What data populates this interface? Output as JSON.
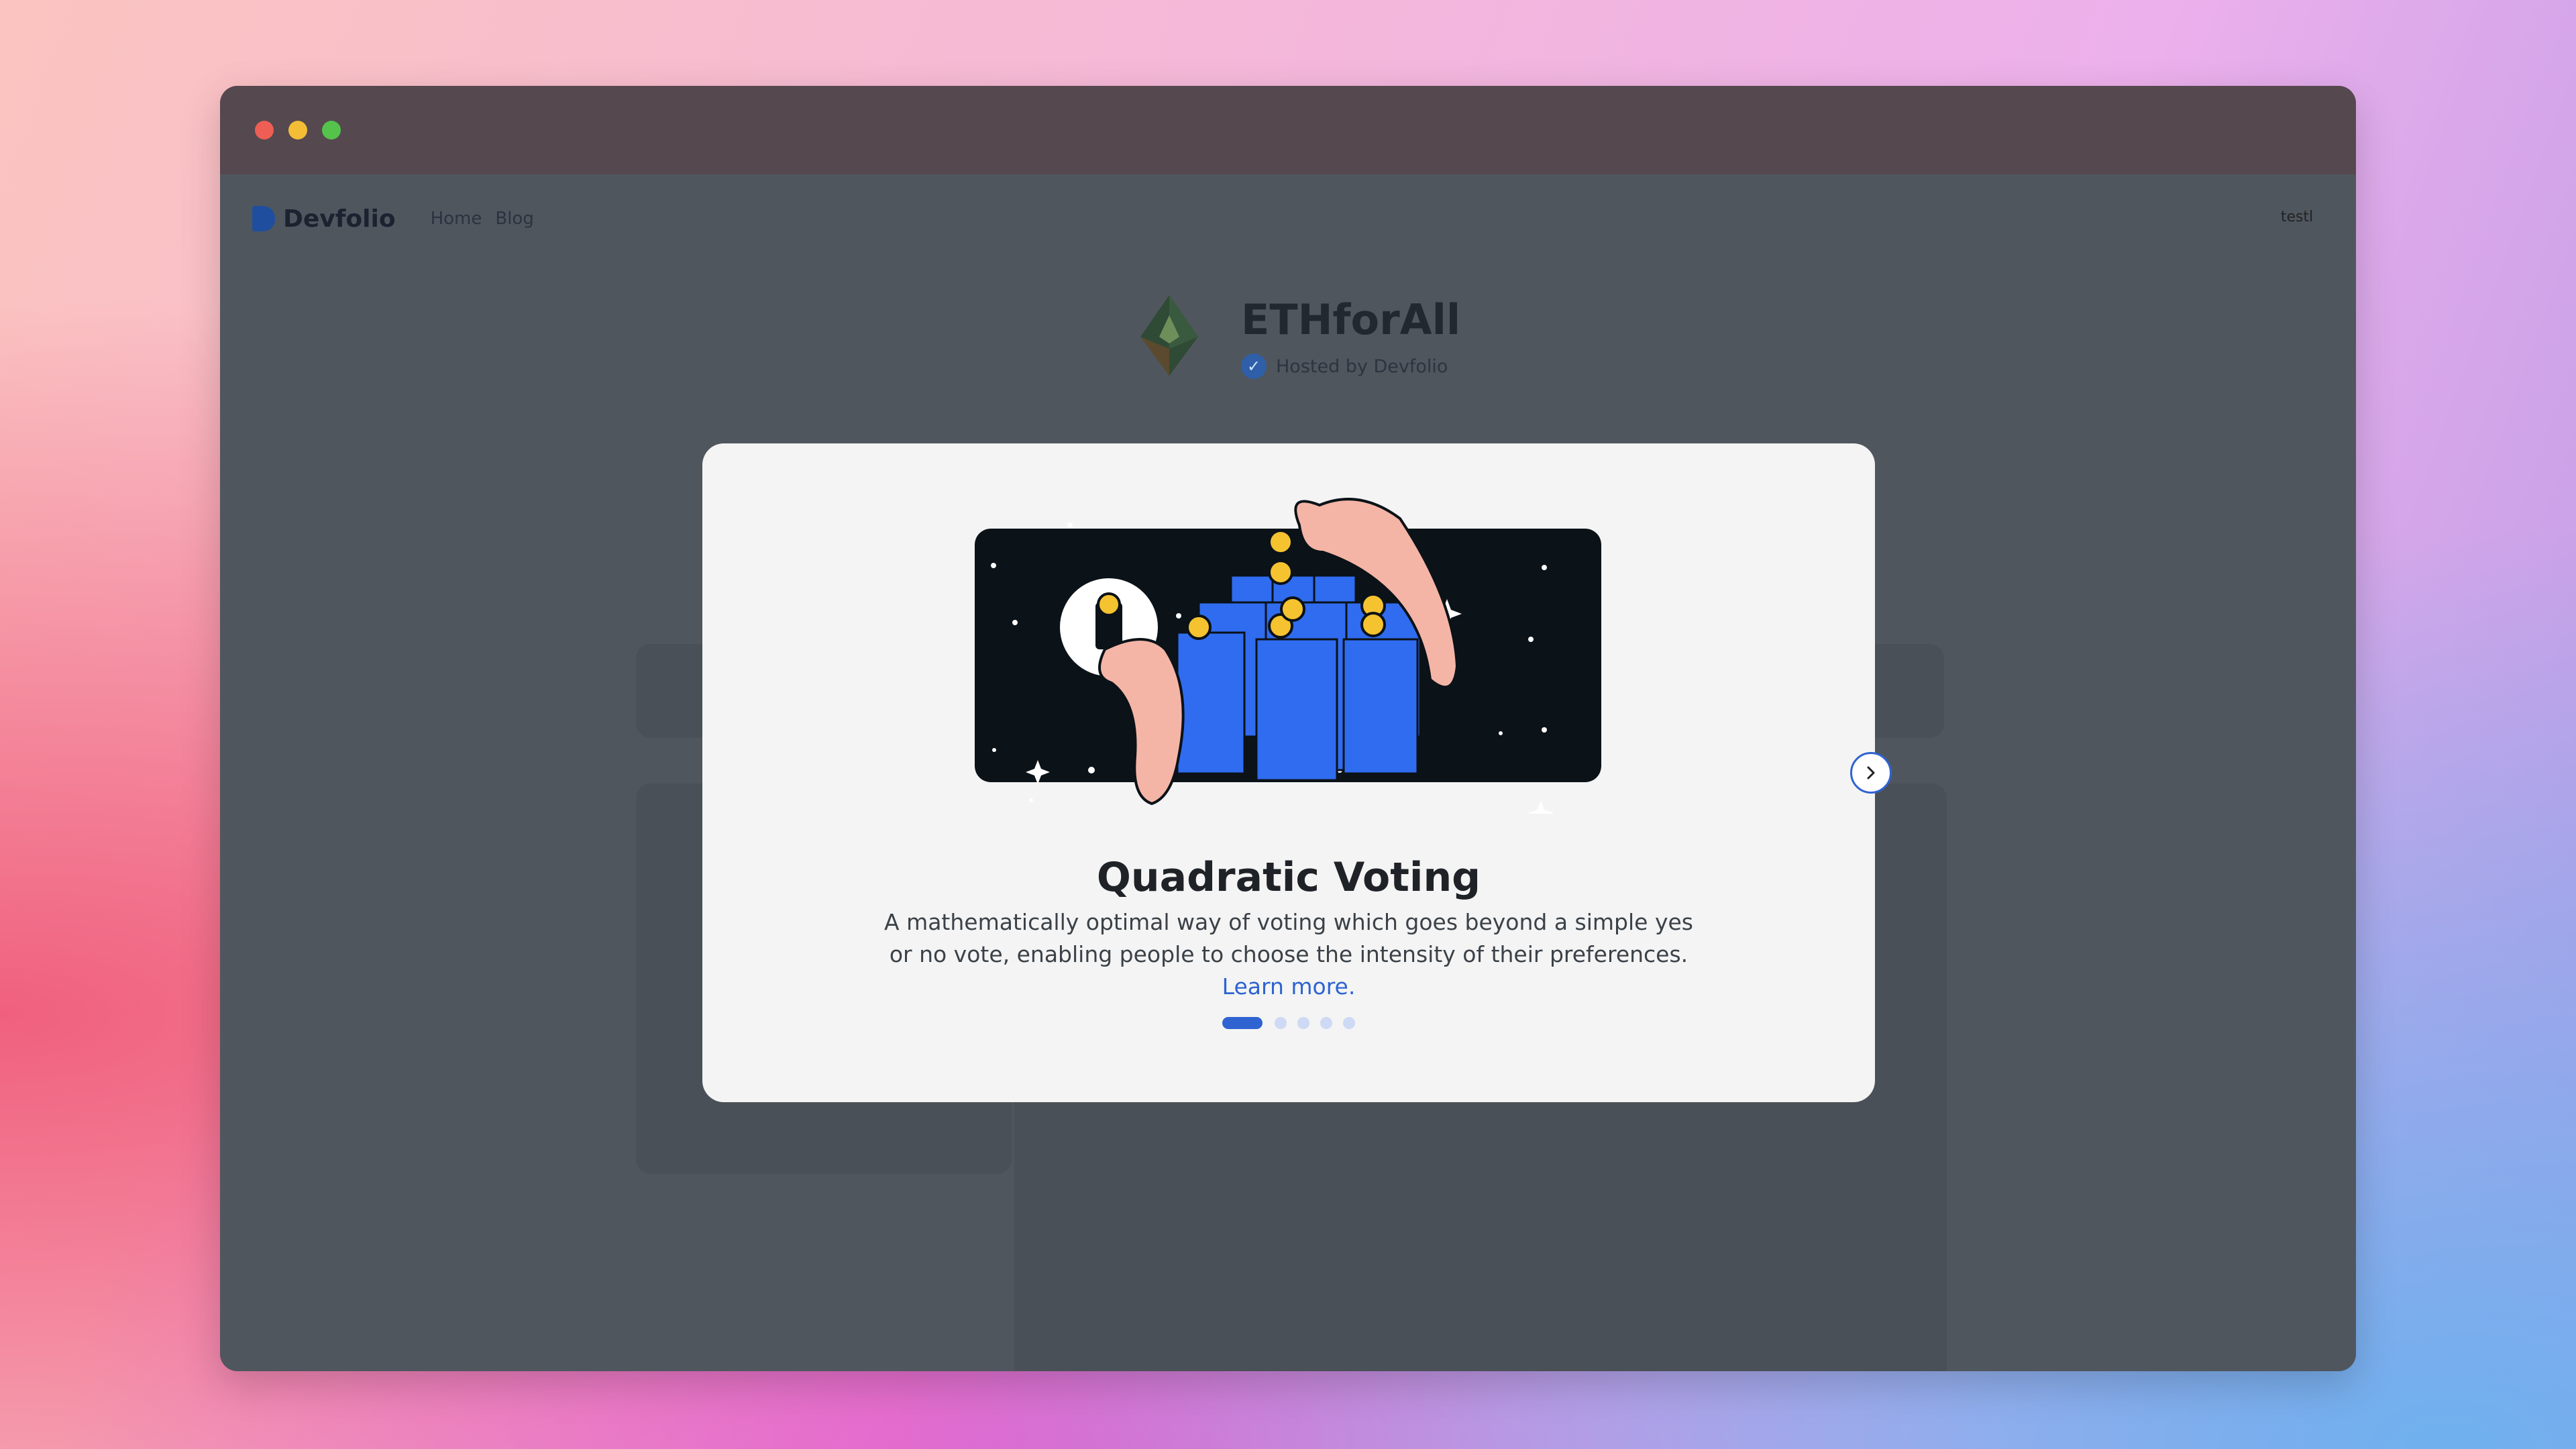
{
  "browser": {
    "traffic_lights": [
      "close",
      "minimize",
      "maximize"
    ]
  },
  "nav": {
    "brand": "Devfolio",
    "links": [
      "Home",
      "Blog"
    ],
    "avatar_alt": "testl"
  },
  "event": {
    "title": "ETHforAll",
    "hosted_by": "Hosted by Devfolio"
  },
  "modal": {
    "title": "Quadratic Voting",
    "description": "A mathematically optimal way of voting which goes beyond a simple yes or no vote, enabling people to choose the intensity of their preferences.",
    "learn_more": "Learn more.",
    "pager": {
      "total": 5,
      "active": 1
    },
    "next_icon": "chevron-right-icon"
  },
  "colors": {
    "accent": "#2f63d2",
    "overlay": "#50565e",
    "modal_bg": "#f3f4f3",
    "ballot_box": "#2f6cf0",
    "coin": "#f5c230",
    "hand": "#f4b5a6"
  }
}
